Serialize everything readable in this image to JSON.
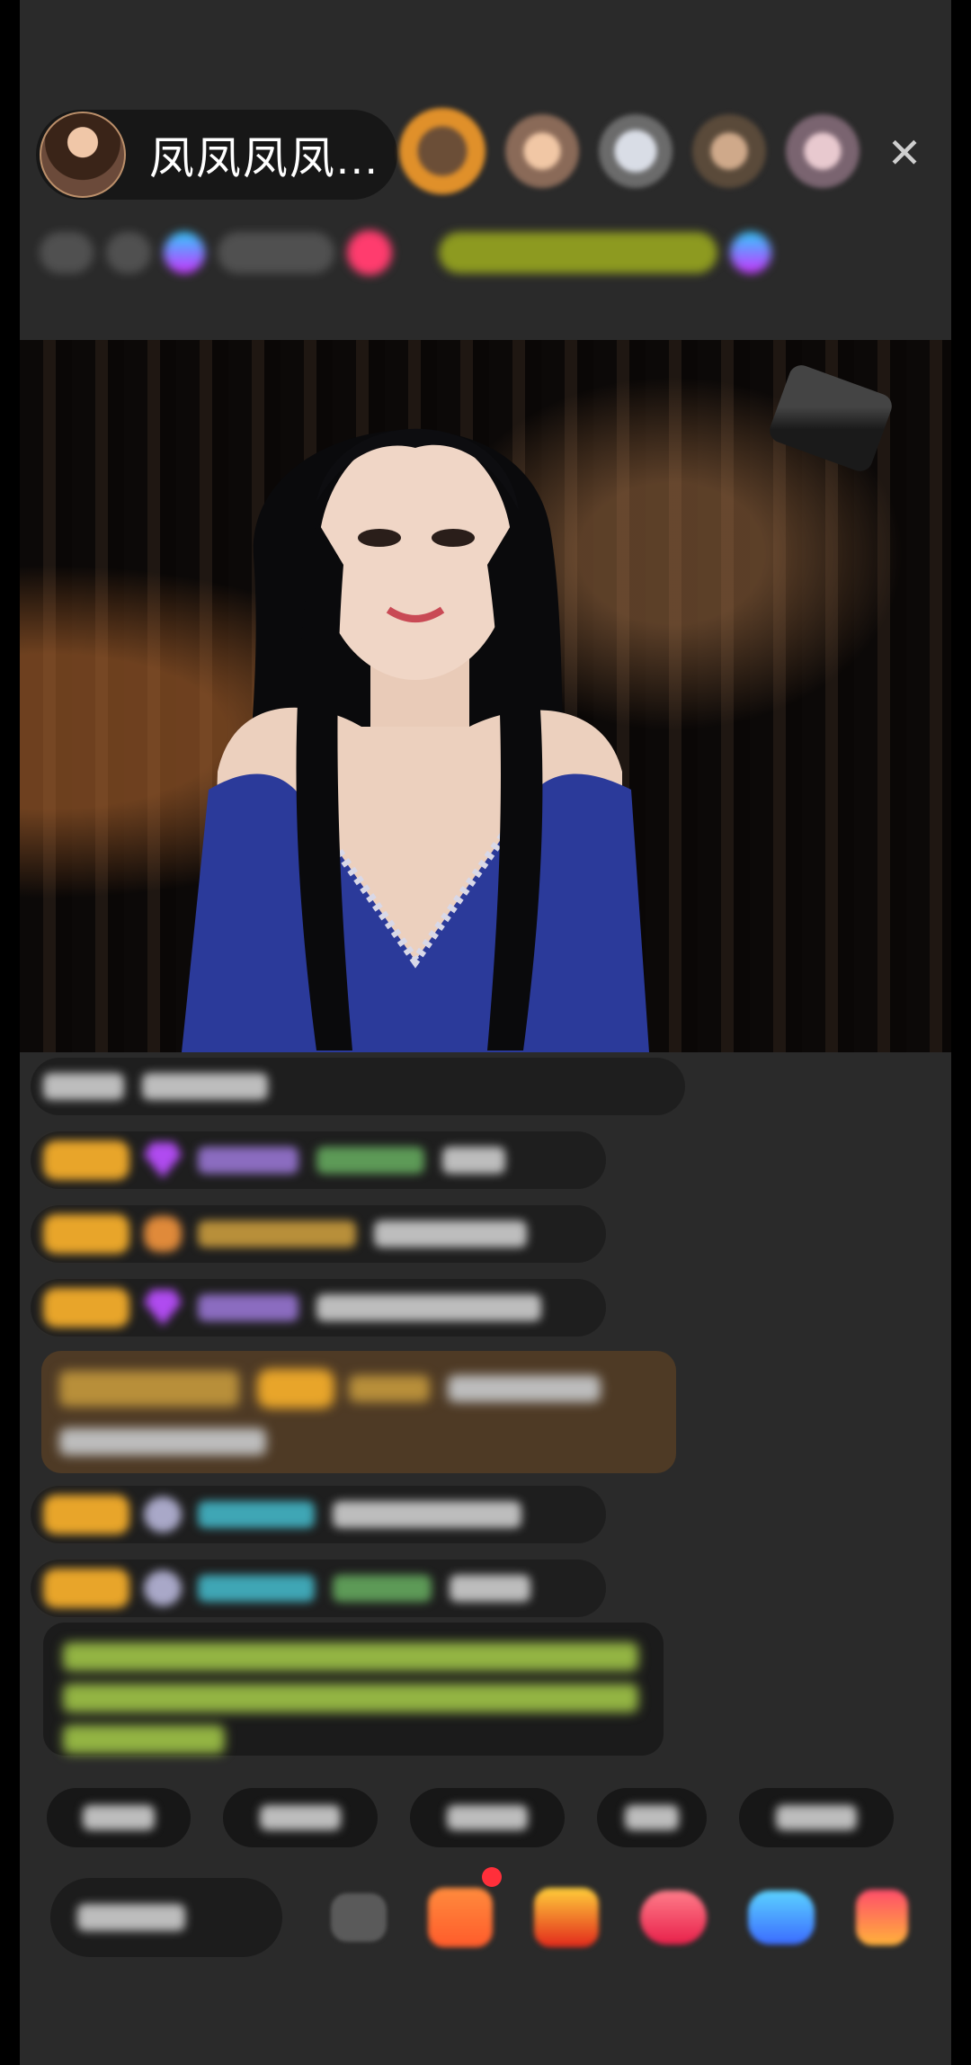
{
  "header": {
    "anchor_name": "凤凤凤凤...",
    "close_glyph": "✕",
    "viewer_avatars": [
      "viewer-avatar-1",
      "viewer-avatar-2",
      "viewer-avatar-3",
      "viewer-avatar-4",
      "viewer-avatar-5"
    ]
  },
  "video": {
    "description_icon": "live-video-stream"
  },
  "chat": {
    "messages_blurred": true
  },
  "colors": {
    "background": "#2a2a2a",
    "badge_gold": "#e8a52a",
    "gift_highlight": "#4e3a25",
    "welcome_green": "#93b443",
    "notification_dot": "#ff2f3a"
  },
  "bottom_bar": {
    "icons": [
      "emoji-icon",
      "gift-box-icon",
      "red-packet-icon",
      "heart-icon",
      "game-icon",
      "menu-icon"
    ]
  }
}
